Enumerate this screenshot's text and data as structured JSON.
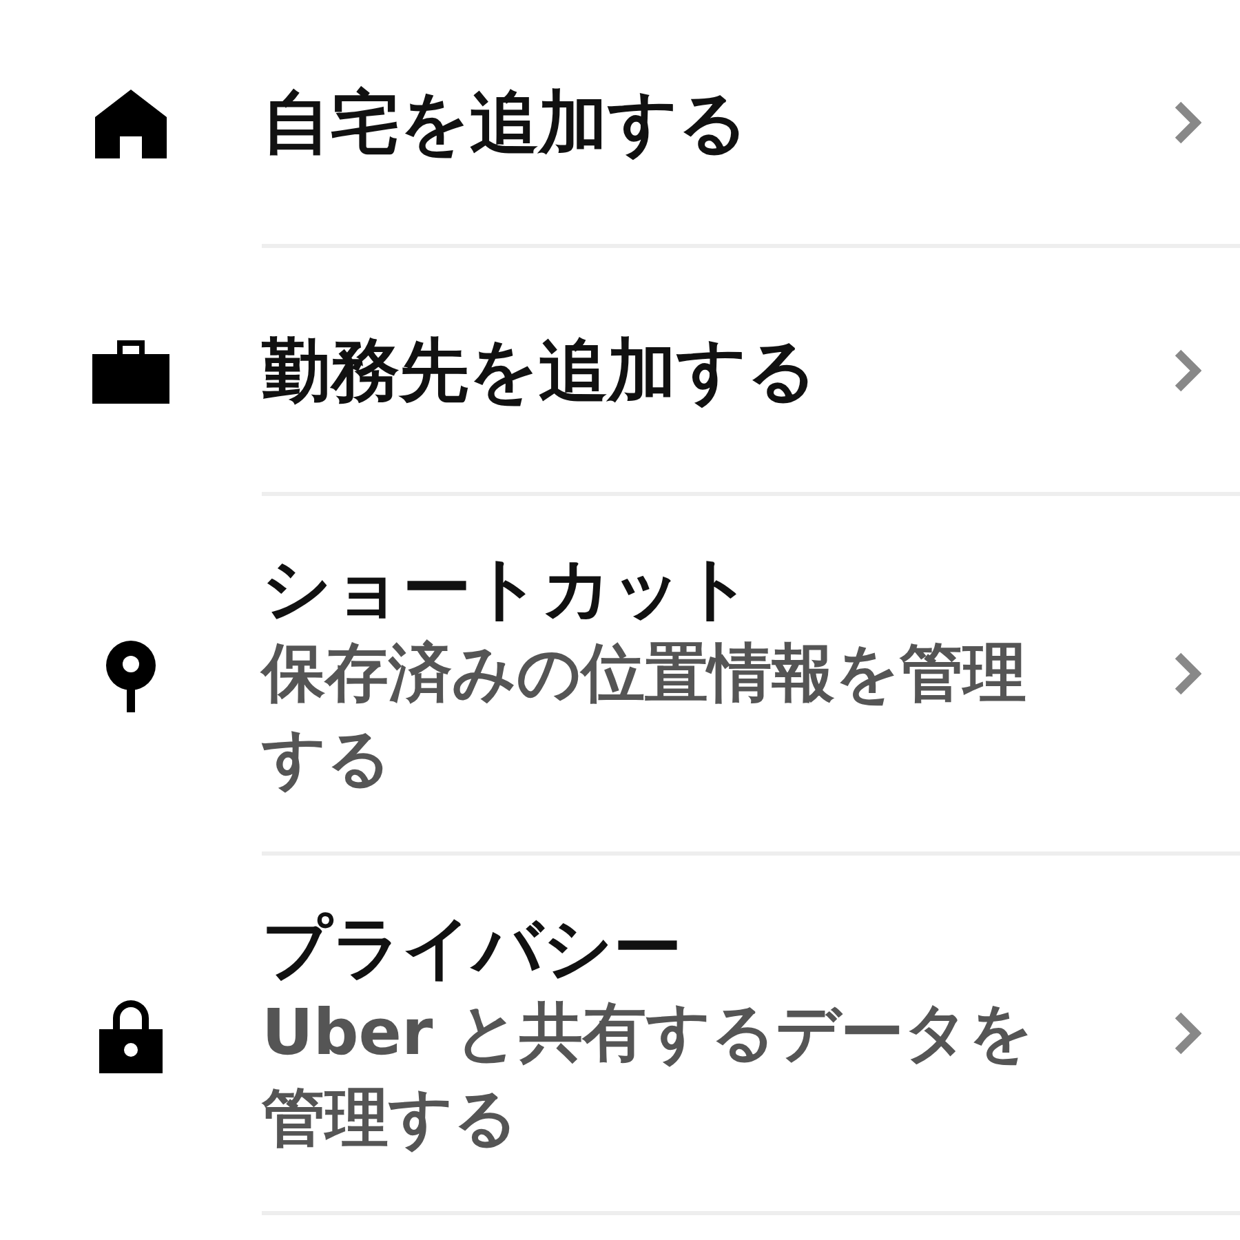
{
  "menu_items": [
    {
      "kind": "home",
      "title": "自宅を追加する"
    },
    {
      "kind": "work",
      "title": "勤務先を追加する"
    },
    {
      "kind": "pin",
      "title": "ショートカット",
      "subtitle": "保存済みの位置情報を管理する"
    },
    {
      "kind": "lock",
      "title": "プライバシー",
      "subtitle": "Uber と共有するデータを管理する"
    }
  ]
}
